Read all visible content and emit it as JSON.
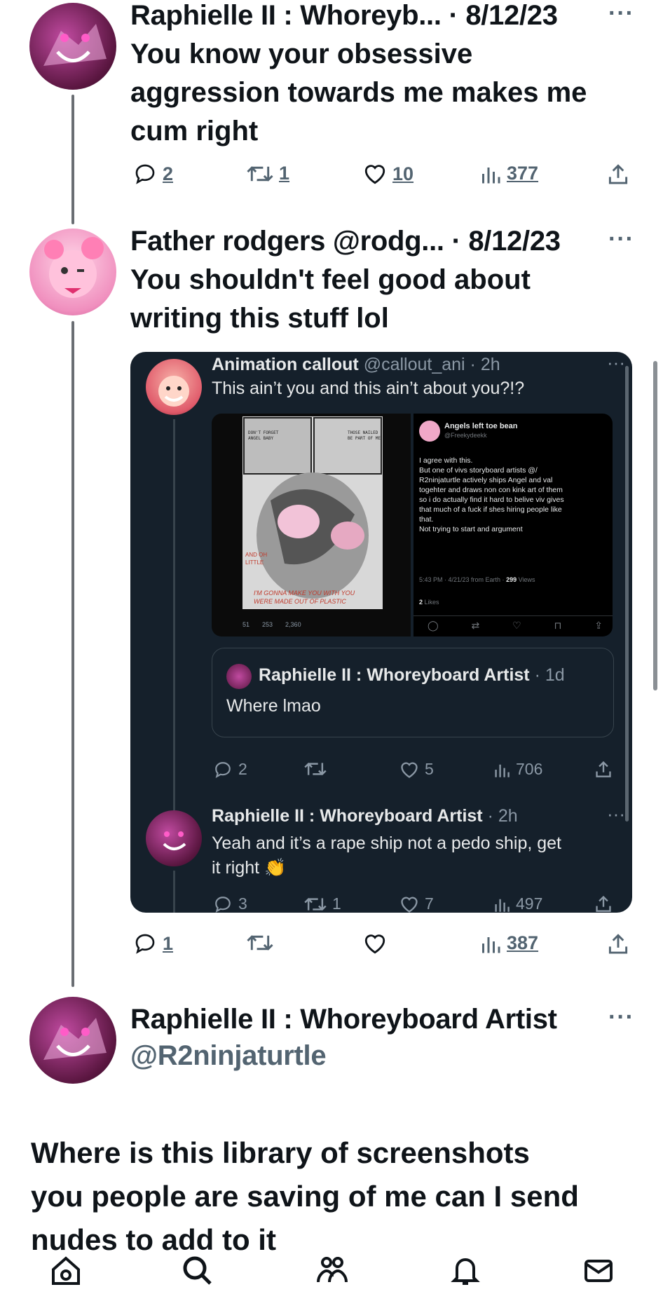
{
  "tweet1": {
    "header": "Raphielle II : Whoreyb... · 8/12/23",
    "text_lines": [
      "You know your obsessive",
      "aggression towards me makes me",
      "cum right"
    ],
    "replies": "2",
    "retweets": "1",
    "likes": "10",
    "views": "377",
    "more_icon": "more-icon"
  },
  "tweet2": {
    "header": "Father rodgers @rodg... · 8/12/23",
    "text_lines": [
      "You shouldn't feel good about",
      "writing this stuff lol"
    ],
    "replies": "1",
    "views": "387",
    "quote": {
      "author": "Animation callout",
      "handle_time": "@callout_ani · 2h",
      "text": "This ain’t you and this ain’t about you?!?",
      "image_left": {
        "lines": [
          "DON'T FORGET",
          "ANGEL BABY",
          "THOSE NAILED",
          "BE PART OF ME"
        ],
        "caption": "I'M GONNA MAKE YOU WITH YOU",
        "caption2": "WERE MADE OUT OF PLASTIC",
        "side": "AND OH LITTLE",
        "stats": [
          "51",
          "253",
          "2,360"
        ]
      },
      "image_right": {
        "name": "Angels left toe bean",
        "handle": "@Freekydeekk",
        "lines": [
          "I agree with this.",
          "But one of vivs storyboard artists @/",
          "R2ninjaturtle actively ships Angel and val",
          "togehter and draws non con kink art of them",
          "so i do actually find it hard to belive viv gives",
          "that much of a fuck if shes hiring people like",
          "that.",
          "Not trying to start and argument"
        ],
        "meta": "5:43 PM · 4/21/23 from Earth ·",
        "views_num": "299",
        "views_label": "Views",
        "likes": "2",
        "likes_label": "Likes"
      },
      "nested": {
        "author": "Raphielle II : Whoreyboard Artist",
        "time": "· 1d",
        "text": "Where lmao"
      },
      "stats": {
        "replies": "2",
        "likes": "5",
        "views": "706"
      },
      "reply": {
        "author": "Raphielle II : Whoreyboard Artist",
        "time": "· 2h",
        "line1": "Yeah and it’s a rape ship not a pedo ship, get",
        "line2": "it right",
        "emoji": "👏",
        "replies": "3",
        "retweets": "1",
        "likes": "7",
        "views": "497"
      }
    }
  },
  "main": {
    "name": "Raphielle II : Whoreyboard Artist",
    "handle": "@R2ninjaturtle",
    "text_lines": [
      "Where is this library of screenshots",
      "you people are saving of me can I send",
      "nudes to add to it"
    ]
  },
  "nav": [
    "home-icon",
    "search-icon",
    "communities-icon",
    "notifications-icon",
    "messages-icon"
  ],
  "colors": {
    "dark_card": "#15202b",
    "text": "#0f1419",
    "secondary": "#536471"
  }
}
